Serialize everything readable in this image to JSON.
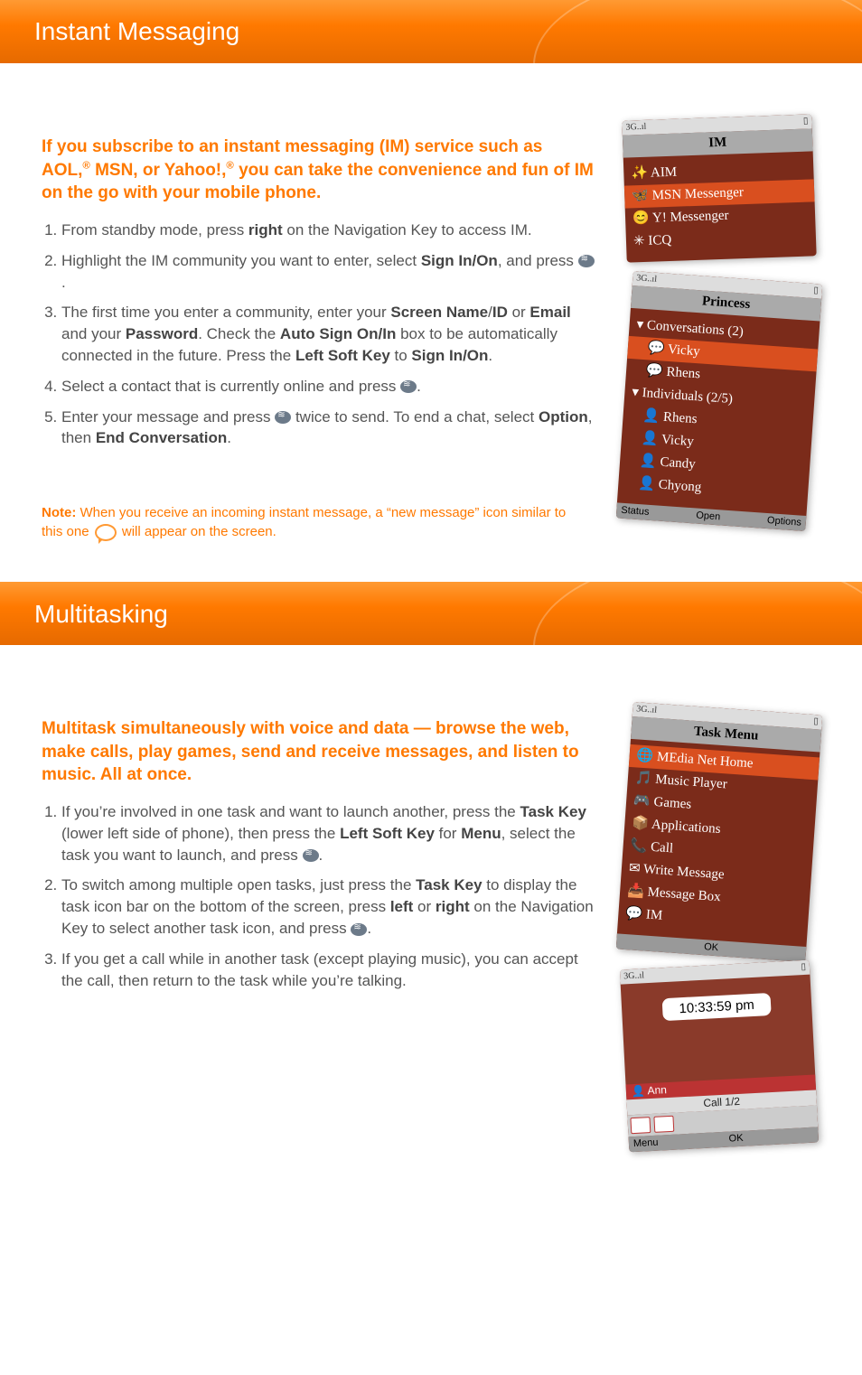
{
  "sections": {
    "im": {
      "title": "Instant Messaging",
      "subhead_part1": "If you subscribe to an instant messaging (IM) service such as AOL,",
      "subhead_reg1": "®",
      "subhead_part2": " MSN, or Yahoo!,",
      "subhead_reg2": "®",
      "subhead_part3": " you can take the convenience and fun of IM on the go with your mobile phone.",
      "steps": {
        "s1_a": "From standby mode, press ",
        "s1_b_key": "right",
        "s1_c": " on the Navigation Key to access IM.",
        "s2_a": "Highlight the IM community you want to enter, select ",
        "s2_b_key": "Sign In/On",
        "s2_c": ", and press ",
        "s2_d_period": ".",
        "s3_a": "The first time you enter a community, enter your ",
        "s3_b_key1": "Screen Name",
        "s3_c_slash": "/",
        "s3_d_key2": "ID",
        "s3_e": " or ",
        "s3_f_key3": "Email",
        "s3_g": " and your ",
        "s3_h_key4": "Password",
        "s3_i": ". Check the ",
        "s3_j_key5": "Auto Sign On/In",
        "s3_k": " box to be automatically connected in the future. Press the ",
        "s3_l_key6": "Left Soft Key",
        "s3_m": " to ",
        "s3_n_key7": "Sign In/On",
        "s3_o_period": ".",
        "s4_a": "Select a contact that is currently online and press ",
        "s4_b_period": ".",
        "s5_a": "Enter your message and press ",
        "s5_b": " twice to send. To end a chat, select ",
        "s5_c_key1": "Option",
        "s5_d": ", then ",
        "s5_e_key2": "End Conversation",
        "s5_f_period": "."
      },
      "note_label": "Note:",
      "note_a": " When you receive an incoming instant message, a “new message” icon similar to this one ",
      "note_b": " will appear on the screen.",
      "phone1": {
        "status_left": "3G..ıl",
        "title": "IM",
        "items": [
          "AIM",
          "MSN Messenger",
          "Y! Messenger",
          "ICQ"
        ],
        "selected": 1
      },
      "phone2": {
        "status_left": "3G..ıl",
        "title": "Princess",
        "group1": "Conversations (2)",
        "items1": [
          "Vicky",
          "Rhens"
        ],
        "group2": "Individuals (2/5)",
        "items2": [
          "Rhens",
          "Vicky",
          "Candy",
          "Chyong"
        ],
        "soft": [
          "Status",
          "Open",
          "Options"
        ]
      }
    },
    "multi": {
      "title": "Multitasking",
      "subhead": "Multitask simultaneously with voice and data — browse the web, make calls, play games, send and receive messages, and listen to music. All at once.",
      "steps": {
        "s1_a": "If you’re involved in one task and want to launch another, press the ",
        "s1_b_key1": "Task Key",
        "s1_c": " (lower left side of phone), then press the ",
        "s1_d_key2": "Left Soft Key",
        "s1_e": " for ",
        "s1_f_key3": "Menu",
        "s1_g": ", select the task you want to launch, and press ",
        "s1_h_period": ".",
        "s2_a": "To switch among multiple open tasks, just press the ",
        "s2_b_key1": "Task Key",
        "s2_c": " to display the task icon bar on the bottom of the screen, press ",
        "s2_d_key2": "left",
        "s2_e": " or ",
        "s2_f_key3": "right",
        "s2_g": " on the Navigation Key to select another task icon, and press ",
        "s2_h_period": ".",
        "s3": "If you get a call while in another task (except playing music), you can accept the call, then return to the task while you’re talking."
      },
      "phone1": {
        "status_left": "3G..ıl",
        "title": "Task Menu",
        "items": [
          "MEdia Net Home",
          "Music Player",
          "Games",
          "Applications",
          "Call",
          "Write Message",
          "Message Box",
          "IM"
        ],
        "selected": 0,
        "soft_center": "OK"
      },
      "phone2": {
        "status_left": "3G..ıl",
        "clock": "10:33:59 pm",
        "caller_name": "Ann",
        "call_text": "Call   1/2",
        "soft": [
          "Menu",
          "OK",
          ""
        ]
      }
    }
  }
}
